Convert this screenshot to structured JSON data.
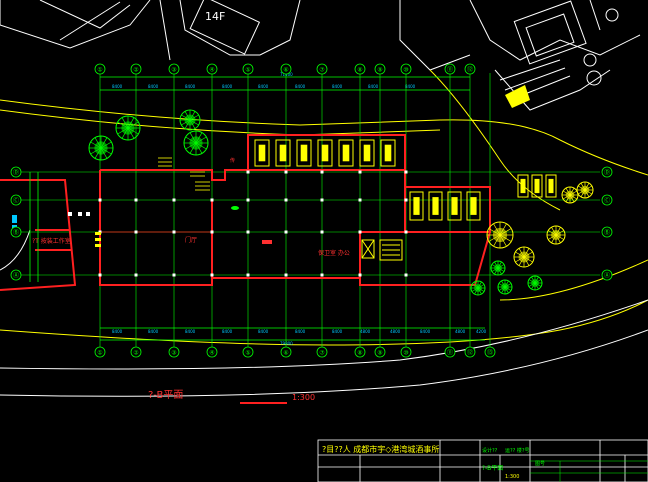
{
  "colors": {
    "background": "#000000",
    "grid_green": "#00ff00",
    "axis_white": "#ffffff",
    "wall_red": "#ff2020",
    "parking_yellow": "#ffff00",
    "tree_green": "#00ff00",
    "dim_cyan": "#00c8ff",
    "text_red": "#ff3030",
    "title_yellow": "#ffff00"
  },
  "drawing": {
    "title": "?-B平面",
    "scale": "1:300",
    "neighbor_label": "14F",
    "room_labels": {
      "left_building": "?T 按装工作室",
      "lobby": "门厅",
      "office": "保卫室 办公",
      "small_room": "传"
    }
  },
  "axes": {
    "top": [
      "①",
      "②",
      "③",
      "④",
      "⑤",
      "⑥",
      "⑦",
      "⑧",
      "⑨",
      "⑩",
      "⑪",
      "⑫"
    ],
    "bottom": [
      "①",
      "②",
      "③",
      "④",
      "⑤",
      "⑥",
      "⑦",
      "⑧",
      "⑨",
      "⑩",
      "⑪",
      "⑫",
      "⑬"
    ],
    "left": [
      "Ⓓ",
      "Ⓒ",
      "Ⓑ",
      "Ⓐ"
    ],
    "right": [
      "Ⓓ",
      "Ⓒ",
      "Ⓑ",
      "Ⓐ"
    ]
  },
  "title_block": {
    "project_line": "?目??人  成都市宇◇港湾城酒事所",
    "row2_left": "设计??",
    "row2_mid": "运?? 楼?号",
    "row2_right": "图号",
    "drawing_name": "?-B平面",
    "scale_label": "1:300"
  }
}
